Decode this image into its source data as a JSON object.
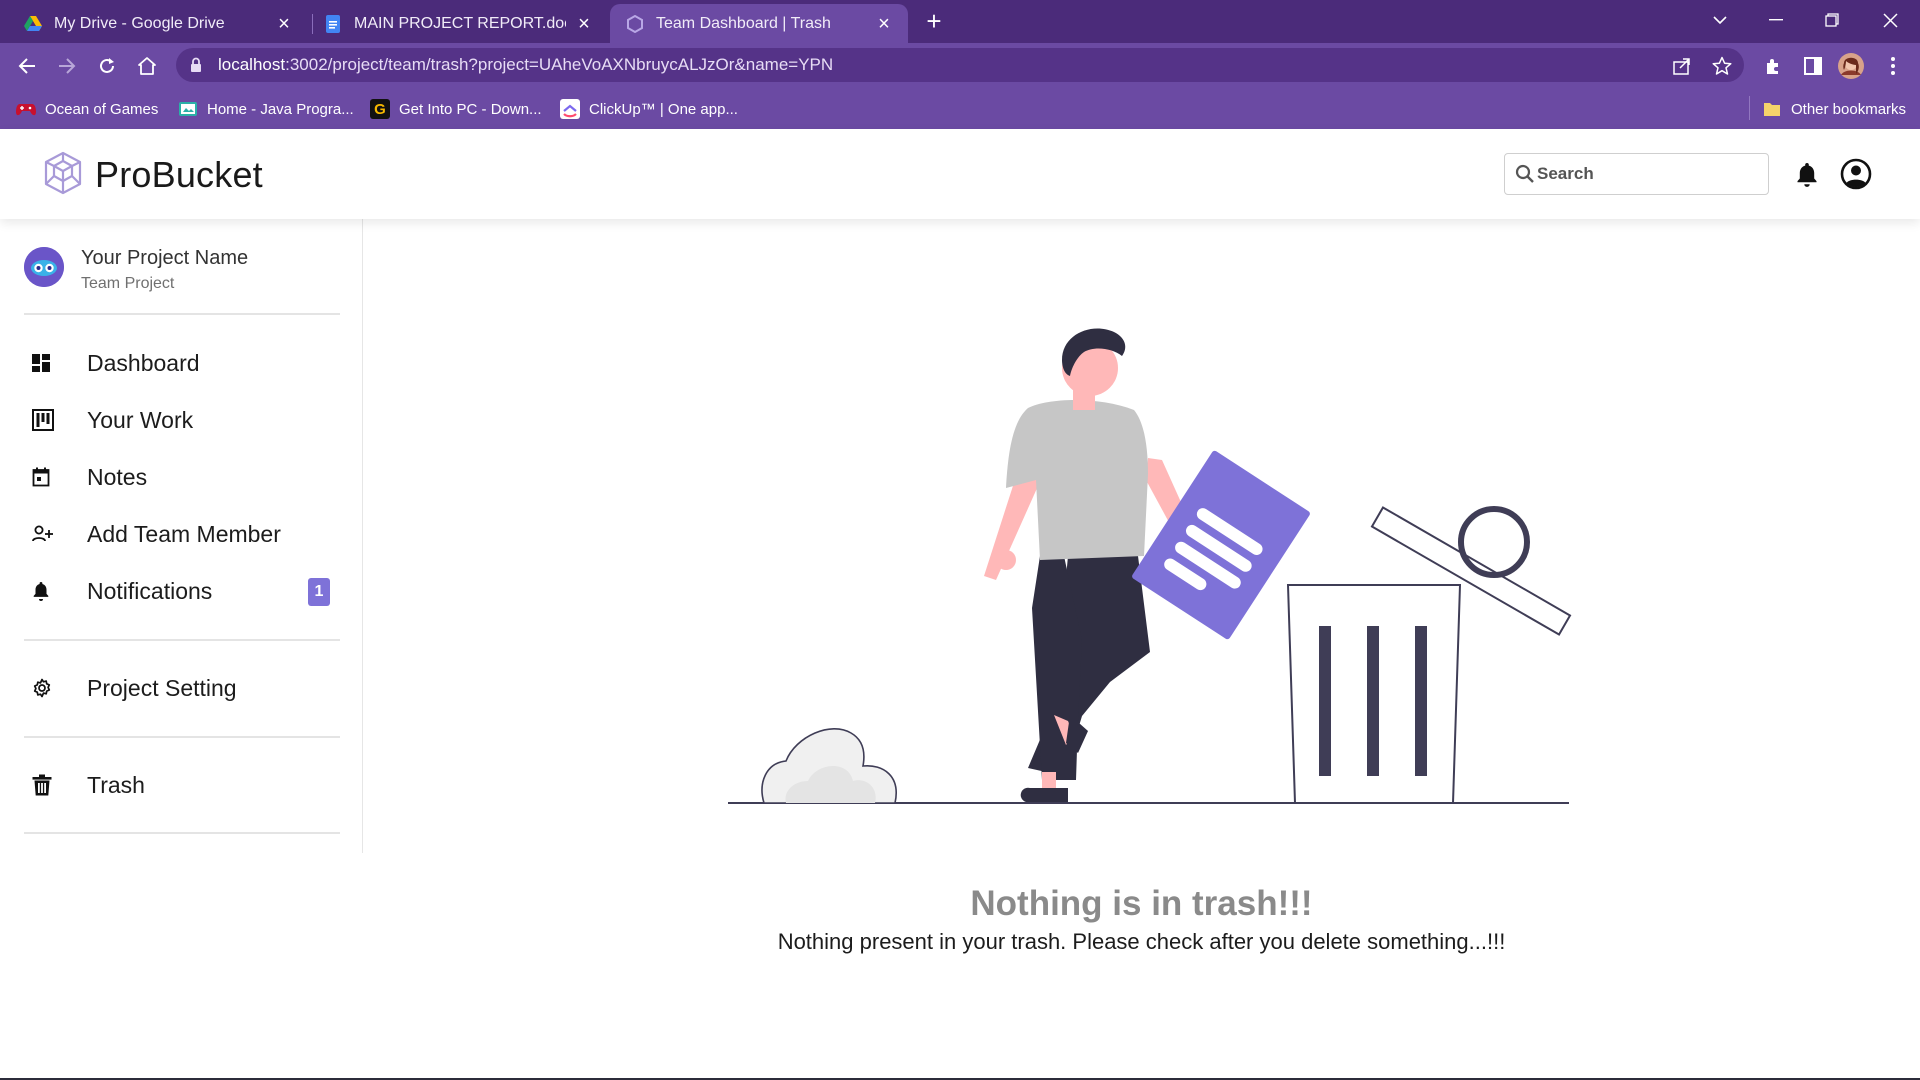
{
  "browser": {
    "tabs": [
      {
        "title": "My Drive - Google Drive",
        "icon": "google-drive-icon"
      },
      {
        "title": "MAIN PROJECT REPORT.docx - G",
        "icon": "google-docs-icon"
      },
      {
        "title": "Team Dashboard | Trash",
        "icon": "probucket-icon",
        "active": true
      }
    ],
    "url_host": "localhost",
    "url_path": ":3002/project/team/trash?project=UAheVoAXNbruycALJzOr&name=YPN",
    "bookmarks": [
      {
        "label": "Ocean of Games",
        "icon": "gamepad-icon"
      },
      {
        "label": "Home - Java Progra...",
        "icon": "java-icon"
      },
      {
        "label": "Get Into PC - Down...",
        "icon": "g-icon"
      },
      {
        "label": "ClickUp™ | One app...",
        "icon": "clickup-icon"
      }
    ],
    "other_bookmarks": "Other bookmarks",
    "accent_color": "#6b4aa3",
    "tabstrip_color": "#4b2b7a"
  },
  "app": {
    "brand": "ProBucket",
    "search_placeholder": "Search",
    "accent": "#7e72d8"
  },
  "sidebar": {
    "project_name": "Your Project Name",
    "project_type": "Team Project",
    "items": [
      {
        "label": "Dashboard",
        "icon": "dashboard-icon"
      },
      {
        "label": "Your Work",
        "icon": "kanban-icon"
      },
      {
        "label": "Notes",
        "icon": "calendar-icon"
      },
      {
        "label": "Add Team Member",
        "icon": "person-add-icon"
      },
      {
        "label": "Notifications",
        "icon": "bell-icon",
        "badge": "1"
      },
      {
        "label": "Project Setting",
        "icon": "gear-icon"
      },
      {
        "label": "Trash",
        "icon": "trash-icon"
      }
    ]
  },
  "main": {
    "empty_title": "Nothing is in trash!!!",
    "empty_description": "Nothing present in your trash. Please check after you delete something...!!!"
  }
}
